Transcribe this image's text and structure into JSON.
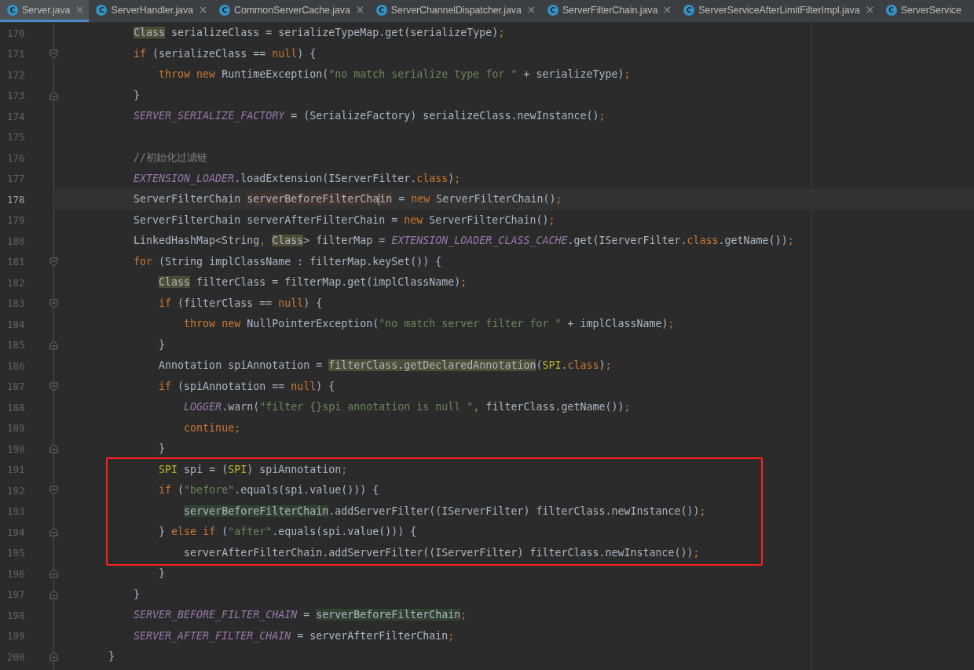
{
  "tabs": [
    {
      "label": "Server.java",
      "icon_label": "C",
      "selected": true,
      "closable": true
    },
    {
      "label": "ServerHandler.java",
      "icon_label": "C",
      "selected": false,
      "closable": true
    },
    {
      "label": "CommonServerCache.java",
      "icon_label": "C",
      "selected": false,
      "closable": true
    },
    {
      "label": "ServerChannelDispatcher.java",
      "icon_label": "C",
      "selected": false,
      "closable": true
    },
    {
      "label": "ServerFilterChain.java",
      "icon_label": "C",
      "selected": false,
      "closable": true
    },
    {
      "label": "ServerServiceAfterLimitFilterImpl.java",
      "icon_label": "C",
      "selected": false,
      "closable": true
    },
    {
      "label": "ServerService",
      "icon_label": "C",
      "selected": false,
      "closable": false
    }
  ],
  "lines": [
    {
      "number": "170",
      "tokens": [
        {
          "t": "        Class",
          "kind": "usage"
        },
        {
          "t": " serializeClass = serializeTypeMap.get(serializeType)",
          "kind": "plain"
        },
        {
          "t": ";",
          "kind": "punct"
        }
      ]
    },
    {
      "number": "171",
      "fold_start": true,
      "tokens": [
        {
          "t": "        if",
          "kind": "kw"
        },
        {
          "t": " (serializeClass == ",
          "kind": "plain"
        },
        {
          "t": "null",
          "kind": "kw"
        },
        {
          "t": ") {",
          "kind": "plain"
        }
      ]
    },
    {
      "number": "172",
      "tokens": [
        {
          "t": "            throw new",
          "kind": "kw"
        },
        {
          "t": " RuntimeException(",
          "kind": "plain"
        },
        {
          "t": "\"no match serialize type for \"",
          "kind": "str"
        },
        {
          "t": " + serializeType)",
          "kind": "plain"
        },
        {
          "t": ";",
          "kind": "punct"
        }
      ]
    },
    {
      "number": "173",
      "fold_end": true,
      "tokens": [
        {
          "t": "        }",
          "kind": "plain"
        }
      ]
    },
    {
      "number": "174",
      "tokens": [
        {
          "t": "        SERVER_SERIALIZE_FACTORY",
          "kind": "const"
        },
        {
          "t": " = (SerializeFactory) serializeClass.newInstance()",
          "kind": "plain"
        },
        {
          "t": ";",
          "kind": "punct"
        }
      ]
    },
    {
      "number": "175"
    },
    {
      "number": "176",
      "tokens": [
        {
          "t": "        //初始化过滤链",
          "kind": "comment"
        }
      ]
    },
    {
      "number": "177",
      "tokens": [
        {
          "t": "        EXTENSION_LOADER",
          "kind": "const"
        },
        {
          "t": ".loadExtension(IServerFilter.",
          "kind": "plain"
        },
        {
          "t": "class",
          "kind": "kw"
        },
        {
          "t": ")",
          "kind": "plain"
        },
        {
          "t": ";",
          "kind": "punct"
        }
      ]
    },
    {
      "number": "178",
      "current": true,
      "tokens": [
        {
          "t": "        ServerFilterChain ",
          "kind": "plain"
        },
        {
          "t": "serverBeforeFilterCha",
          "kind": "write"
        },
        {
          "t": "in",
          "kind": "write",
          "caret": true
        },
        {
          "t": " = ",
          "kind": "plain"
        },
        {
          "t": "new",
          "kind": "kw"
        },
        {
          "t": " ServerFilterChain()",
          "kind": "plain"
        },
        {
          "t": ";",
          "kind": "punct"
        }
      ]
    },
    {
      "number": "179",
      "tokens": [
        {
          "t": "        ServerFilterChain serverAfterFilterChain = ",
          "kind": "plain"
        },
        {
          "t": "new",
          "kind": "kw"
        },
        {
          "t": " ServerFilterChain()",
          "kind": "plain"
        },
        {
          "t": ";",
          "kind": "punct"
        }
      ]
    },
    {
      "number": "180",
      "tokens": [
        {
          "t": "        LinkedHashMap<String",
          "kind": "plain"
        },
        {
          "t": ", ",
          "kind": "punct"
        },
        {
          "t": "Class",
          "kind": "usage"
        },
        {
          "t": "> filterMap = ",
          "kind": "plain"
        },
        {
          "t": "EXTENSION_LOADER_CLASS_CACHE",
          "kind": "const"
        },
        {
          "t": ".get(IServerFilter.",
          "kind": "plain"
        },
        {
          "t": "class",
          "kind": "kw"
        },
        {
          "t": ".getName())",
          "kind": "plain"
        },
        {
          "t": ";",
          "kind": "punct"
        }
      ]
    },
    {
      "number": "181",
      "fold_start": true,
      "tokens": [
        {
          "t": "        for",
          "kind": "kw"
        },
        {
          "t": " (String implClassName : filterMap.keySet()) {",
          "kind": "plain"
        }
      ]
    },
    {
      "number": "182",
      "tokens": [
        {
          "t": "            Class",
          "kind": "usage"
        },
        {
          "t": " filterClass = filterMap.get(implClassName)",
          "kind": "plain"
        },
        {
          "t": ";",
          "kind": "punct"
        }
      ]
    },
    {
      "number": "183",
      "fold_start": true,
      "tokens": [
        {
          "t": "            if",
          "kind": "kw"
        },
        {
          "t": " (filterClass == ",
          "kind": "plain"
        },
        {
          "t": "null",
          "kind": "kw"
        },
        {
          "t": ") {",
          "kind": "plain"
        }
      ]
    },
    {
      "number": "184",
      "tokens": [
        {
          "t": "                throw new",
          "kind": "kw"
        },
        {
          "t": " NullPointerException(",
          "kind": "plain"
        },
        {
          "t": "\"no match server filter for \"",
          "kind": "str"
        },
        {
          "t": " + implClassName)",
          "kind": "plain"
        },
        {
          "t": ";",
          "kind": "punct"
        }
      ]
    },
    {
      "number": "185",
      "fold_end": true,
      "tokens": [
        {
          "t": "            }",
          "kind": "plain"
        }
      ]
    },
    {
      "number": "186",
      "tokens": [
        {
          "t": "            Annotation spiAnnotation = ",
          "kind": "plain"
        },
        {
          "t": "filterClass.getDeclaredAnnotation",
          "kind": "usage"
        },
        {
          "t": "(",
          "kind": "plain"
        },
        {
          "t": "SPI",
          "kind": "type"
        },
        {
          "t": ".",
          "kind": "plain"
        },
        {
          "t": "class",
          "kind": "kw"
        },
        {
          "t": ")",
          "kind": "plain"
        },
        {
          "t": ";",
          "kind": "punct"
        }
      ]
    },
    {
      "number": "187",
      "fold_start": true,
      "tokens": [
        {
          "t": "            if",
          "kind": "kw"
        },
        {
          "t": " (spiAnnotation == ",
          "kind": "plain"
        },
        {
          "t": "null",
          "kind": "kw"
        },
        {
          "t": ") {",
          "kind": "plain"
        }
      ]
    },
    {
      "number": "188",
      "tokens": [
        {
          "t": "                LOGGER",
          "kind": "const"
        },
        {
          "t": ".warn(",
          "kind": "plain"
        },
        {
          "t": "\"filter {}spi annotation is null \"",
          "kind": "str"
        },
        {
          "t": ",",
          "kind": "punct"
        },
        {
          "t": " filterClass.getName())",
          "kind": "plain"
        },
        {
          "t": ";",
          "kind": "punct"
        }
      ]
    },
    {
      "number": "189",
      "tokens": [
        {
          "t": "                continue;",
          "kind": "kw"
        }
      ]
    },
    {
      "number": "190",
      "fold_end": true,
      "tokens": [
        {
          "t": "            }",
          "kind": "plain"
        }
      ]
    },
    {
      "number": "191",
      "in_box": true,
      "tokens": [
        {
          "t": "            SPI",
          "kind": "type"
        },
        {
          "t": " spi = (",
          "kind": "plain"
        },
        {
          "t": "SPI",
          "kind": "type"
        },
        {
          "t": ") spiAnnotation",
          "kind": "plain"
        },
        {
          "t": ";",
          "kind": "punct"
        }
      ]
    },
    {
      "number": "192",
      "fold_start": true,
      "in_box": true,
      "tokens": [
        {
          "t": "            if",
          "kind": "kw"
        },
        {
          "t": " (",
          "kind": "plain"
        },
        {
          "t": "\"before\"",
          "kind": "str"
        },
        {
          "t": ".equals(spi.value())) {",
          "kind": "plain"
        }
      ]
    },
    {
      "number": "193",
      "in_box": true,
      "tokens": [
        {
          "t": "                serverBeforeFilterChain",
          "kind": "read"
        },
        {
          "t": ".addServerFilter((IServerFilter) filterClass.newInstance())",
          "kind": "plain"
        },
        {
          "t": ";",
          "kind": "punct"
        }
      ]
    },
    {
      "number": "194",
      "fold_end": true,
      "in_box": true,
      "tokens": [
        {
          "t": "            } ",
          "kind": "plain"
        },
        {
          "t": "else if",
          "kind": "kw"
        },
        {
          "t": " (",
          "kind": "plain"
        },
        {
          "t": "\"after\"",
          "kind": "str"
        },
        {
          "t": ".equals(spi.value())) {",
          "kind": "plain"
        }
      ]
    },
    {
      "number": "195",
      "in_box": true,
      "tokens": [
        {
          "t": "                serverAfterFilterChain.addServerFilter((IServerFilter) filterClass.newInstance())",
          "kind": "plain"
        },
        {
          "t": ";",
          "kind": "punct"
        }
      ]
    },
    {
      "number": "196",
      "fold_end": true,
      "tokens": [
        {
          "t": "            }",
          "kind": "plain"
        }
      ]
    },
    {
      "number": "197",
      "fold_end": true,
      "tokens": [
        {
          "t": "        }",
          "kind": "plain"
        }
      ]
    },
    {
      "number": "198",
      "tokens": [
        {
          "t": "        SERVER_BEFORE_FILTER_CHAIN",
          "kind": "const"
        },
        {
          "t": " = ",
          "kind": "plain"
        },
        {
          "t": "serverBeforeFilterChain",
          "kind": "read"
        },
        {
          "t": ";",
          "kind": "punct"
        }
      ]
    },
    {
      "number": "199",
      "tokens": [
        {
          "t": "        SERVER_AFTER_FILTER_CHAIN",
          "kind": "const"
        },
        {
          "t": " = serverAfterFilterChain",
          "kind": "plain"
        },
        {
          "t": ";",
          "kind": "punct"
        }
      ]
    },
    {
      "number": "200",
      "fold_end": true,
      "tokens": [
        {
          "t": "    }",
          "kind": "plain"
        }
      ]
    }
  ],
  "annotation_box": {
    "color": "#ff2020"
  }
}
